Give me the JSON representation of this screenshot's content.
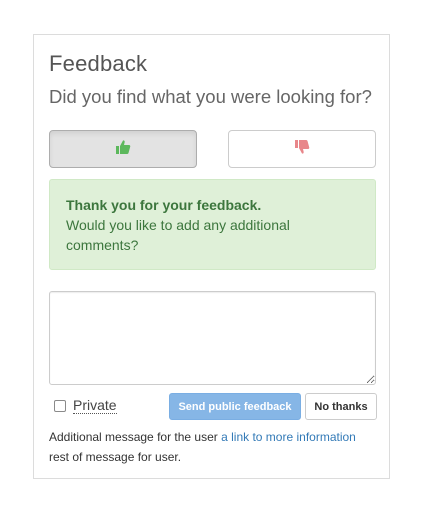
{
  "feedback": {
    "title": "Feedback",
    "question": "Did you find what you were looking for?",
    "thumbs_up_icon": "thumbs-up-icon",
    "thumbs_down_icon": "thumbs-down-icon",
    "colors": {
      "thumbs_up": "#5cb85c",
      "thumbs_down": "#e8868a",
      "alert_bg": "#dff0d8",
      "alert_text": "#3c763d",
      "send_button": "#86b6e6",
      "link": "#337ab7"
    },
    "alert": {
      "heading": "Thank you for your feedback.",
      "body": "Would you like to add any additional comments?"
    },
    "comment": {
      "value": "",
      "placeholder": ""
    },
    "private_label": "Private",
    "send_label": "Send public feedback",
    "no_thanks_label": "No thanks",
    "message": {
      "prefix": "Additional message for the user ",
      "link_text": "a link to more information",
      "suffix": "rest of message for user."
    }
  }
}
